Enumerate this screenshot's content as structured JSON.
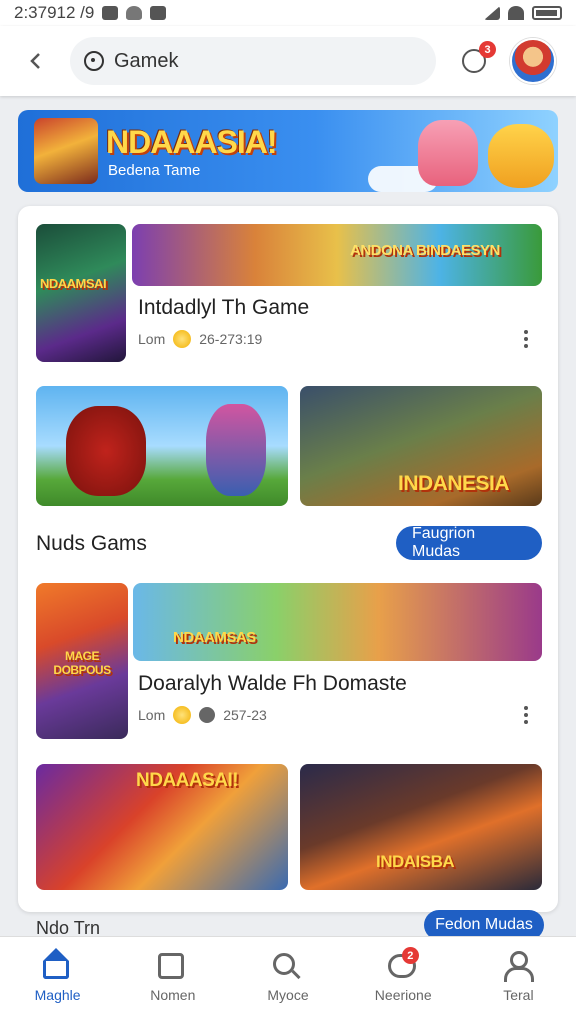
{
  "status_bar": {
    "time": "2:37912 /9"
  },
  "header": {
    "search_value": "Gamek",
    "notification_count": "3"
  },
  "banner": {
    "title": "NDAAASIA!",
    "subtitle": "Bedena Tame"
  },
  "games": [
    {
      "title": "Intdadlyl Th Game",
      "meta_prefix": "Lom",
      "meta_value": "26-273:19",
      "thumb_text": "NDAAMSAI",
      "wide_text": "ANDONA BINDAESYN",
      "art_left_text": "",
      "art_right_text": "INDANESIA"
    },
    {
      "title": "Doaralyh Walde Fh Domaste",
      "meta_prefix": "Lom",
      "meta_value": "257-23",
      "thumb_text": "MAGE DOBPOUS",
      "wide_text": "NDAAMSAS",
      "art_left_text": "NDAAASAI!",
      "art_right_text": "INDAISBA"
    }
  ],
  "sections": [
    {
      "label": "Nuds Gams",
      "button": "Faugrion Mudas"
    },
    {
      "label": "Ndo Trn",
      "button": "Fedon Mudas"
    }
  ],
  "bottom_nav": [
    {
      "label": "Maghle",
      "icon": "home-icon",
      "active": true
    },
    {
      "label": "Nomen",
      "icon": "box-icon"
    },
    {
      "label": "Myoce",
      "icon": "search-icon"
    },
    {
      "label": "Neerione",
      "icon": "chat-icon",
      "badge": "2"
    },
    {
      "label": "Teral",
      "icon": "user-icon"
    }
  ],
  "colors": {
    "accent": "#1f5fc4",
    "badge": "#e53935",
    "banner": "#2f7fe6"
  }
}
